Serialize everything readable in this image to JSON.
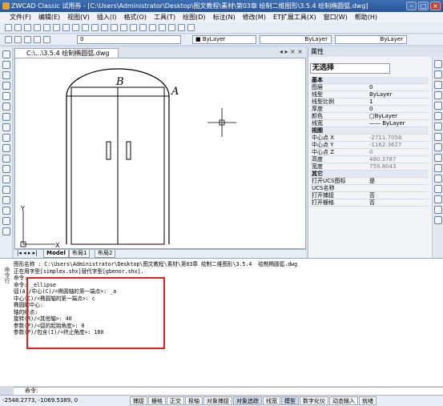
{
  "window": {
    "title": "ZWCAD Classic 试用券 - [C:\\Users\\Administrator\\Desktop\\图文教程\\素材\\第03章 绘制二维图形\\3.5.4  绘制椭圆弧.dwg]",
    "min": "–",
    "max": "□",
    "close": "×"
  },
  "menu": [
    "文件(F)",
    "编辑(E)",
    "视图(V)",
    "插入(I)",
    "格式(O)",
    "工具(T)",
    "绘图(D)",
    "标注(N)",
    "修改(M)",
    "ET扩展工具(X)",
    "窗口(W)",
    "帮助(H)"
  ],
  "toolbar2": {
    "layer_value": "0",
    "color_value": "ByLayer",
    "linetype_value": "ByLayer",
    "lineweight_value": "ByLayer"
  },
  "doc": {
    "tab_label": "C:\\...\\3.5.4  绘制椭圆弧.dwg",
    "tab_controls": "◂ ▸ × ×"
  },
  "drawing": {
    "label_b": "B",
    "label_a": "A",
    "ucs_x": "X",
    "ucs_y": "Y"
  },
  "layout_tabs": [
    "Model",
    "布局1",
    "布局2"
  ],
  "props": {
    "header": "属性",
    "selection": "无选择",
    "rows": [
      {
        "k": "基本",
        "v": "",
        "section": true
      },
      {
        "k": "图层",
        "v": "0"
      },
      {
        "k": "线型",
        "v": "ByLayer"
      },
      {
        "k": "线型比例",
        "v": "1"
      },
      {
        "k": "厚度",
        "v": "0"
      },
      {
        "k": "颜色",
        "v": "□ByLayer"
      },
      {
        "k": "线宽",
        "v": "—— ByLayer"
      },
      {
        "k": "视图",
        "v": "",
        "section": true
      },
      {
        "k": "中心点 X",
        "v": "-2711.7058",
        "dim": true
      },
      {
        "k": "中心点 Y",
        "v": "-1162.3627",
        "dim": true
      },
      {
        "k": "中心点 Z",
        "v": "0",
        "dim": true
      },
      {
        "k": "高度",
        "v": "480.3787",
        "dim": true
      },
      {
        "k": "宽度",
        "v": "759.8043",
        "dim": true
      },
      {
        "k": "其它",
        "v": "",
        "section": true
      },
      {
        "k": "打开UCS图标",
        "v": "是"
      },
      {
        "k": "UCS名称",
        "v": ""
      },
      {
        "k": "打开捕捉",
        "v": "否"
      },
      {
        "k": "打开栅格",
        "v": "否"
      }
    ]
  },
  "command": {
    "side_label": "命令行",
    "lines": [
      "图形名称 : C:\\Users\\Administrator\\Desktop\\图文教程\\素材\\第03章 绘制二维图形\\3.5.4  绘制椭圆弧.dwg",
      "正在用字型[simplex.shx]替代字型[gbenor.shx].",
      "命令:",
      "命令: _ellipse",
      "弧(A)/中心(C)/<椭圆轴的第一端点>: _a",
      "中心(C)/<椭圆轴的第一端点>: c",
      "椭圆的中心:",
      "轴的终点:",
      "旋转(R)/<其他轴>: 40",
      "参数(P)/<弧的起始角度>: 0",
      "参数(P)/包含(I)/<终止角度>: 180",
      "",
      "",
      "",
      "",
      "",
      ""
    ],
    "prompt": "命令:"
  },
  "status": {
    "coords": "-2548.2773, -1069.5389, 0",
    "buttons": [
      "捕捉",
      "栅格",
      "正交",
      "极轴",
      "对象捕捉",
      "对象追踪",
      "线宽",
      "模型",
      "数字化仪",
      "动态输入",
      "就绪"
    ]
  }
}
